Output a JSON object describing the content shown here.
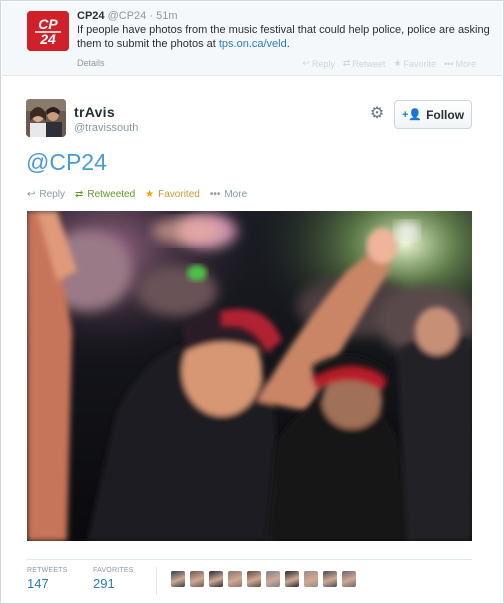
{
  "parent_tweet": {
    "name": "CP24",
    "handle": "@CP24",
    "separator": "·",
    "time": "51m",
    "text_before_link": "If people have photos from the music festival that could help police, police are asking them to submit the photos at ",
    "link": "tps.on.ca/veld",
    "text_after_link": ".",
    "details_label": "Details",
    "actions": {
      "reply": "Reply",
      "retweet": "Retweet",
      "favorite": "Favorite",
      "more": "More"
    },
    "logo_text_top": "CP",
    "logo_text_bottom": "24"
  },
  "tweet": {
    "user_name": "trAvis",
    "user_handle": "@travissouth",
    "follow_label": "Follow",
    "text": "@CP24",
    "actions": {
      "reply": "Reply",
      "retweeted": "Retweeted",
      "favorited": "Favorited",
      "more": "More"
    },
    "icons": {
      "settings": "gear-icon",
      "follow": "add-user-icon",
      "reply": "reply-icon",
      "retweet": "retweet-icon",
      "favorite": "star-icon",
      "more": "ellipsis-icon"
    }
  },
  "stats": {
    "retweets_label": "RETWEETS",
    "retweets_count": "147",
    "favorites_label": "FAVORITES",
    "favorites_count": "291",
    "favoriter_avatar_count": 10
  },
  "colors": {
    "cp24_red": "#d0202a",
    "link_blue": "#2b7bb9",
    "mention_blue": "#4a9ad4",
    "retweet_green": "#609928",
    "favorite_orange": "#f5a20a",
    "muted_gray": "#8899a6"
  }
}
